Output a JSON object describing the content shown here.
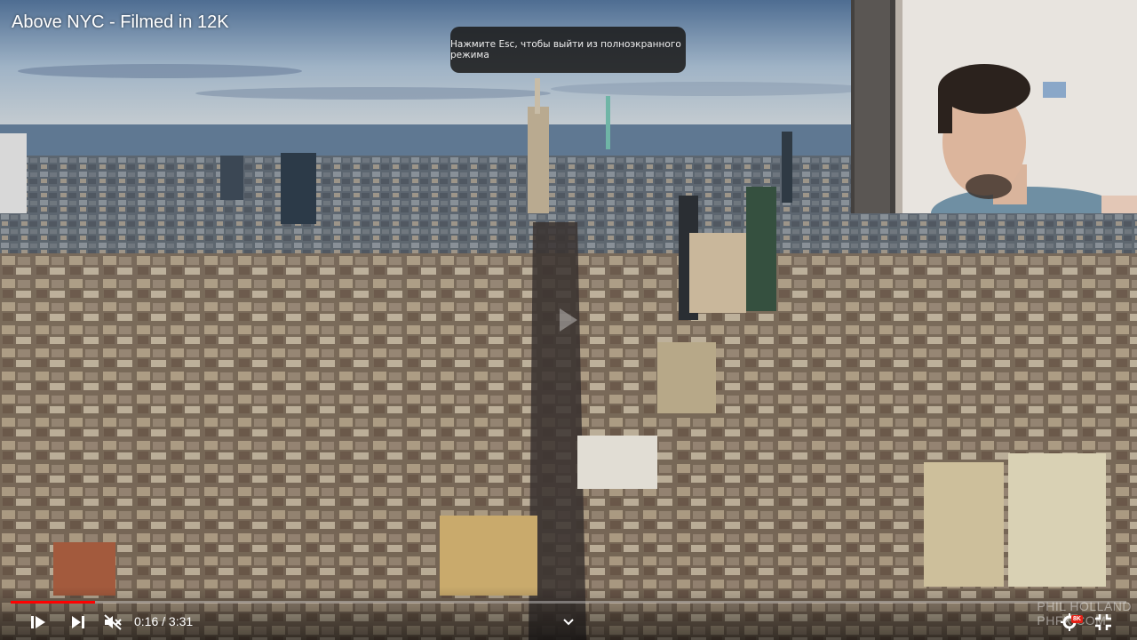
{
  "video": {
    "title": "Above NYC - Filmed in 12K",
    "progress": 0.076
  },
  "toast": {
    "message": "Нажмите Esc, чтобы выйти из полноэкранного режима"
  },
  "controls": {
    "time": "0:16 / 3:31",
    "quality_badge": "8K"
  },
  "watermark": {
    "line1": "PHIL HOLLAND",
    "line2": "PHFX.COM"
  },
  "colors": {
    "accent": "#ff0000",
    "badge": "#e62117"
  }
}
